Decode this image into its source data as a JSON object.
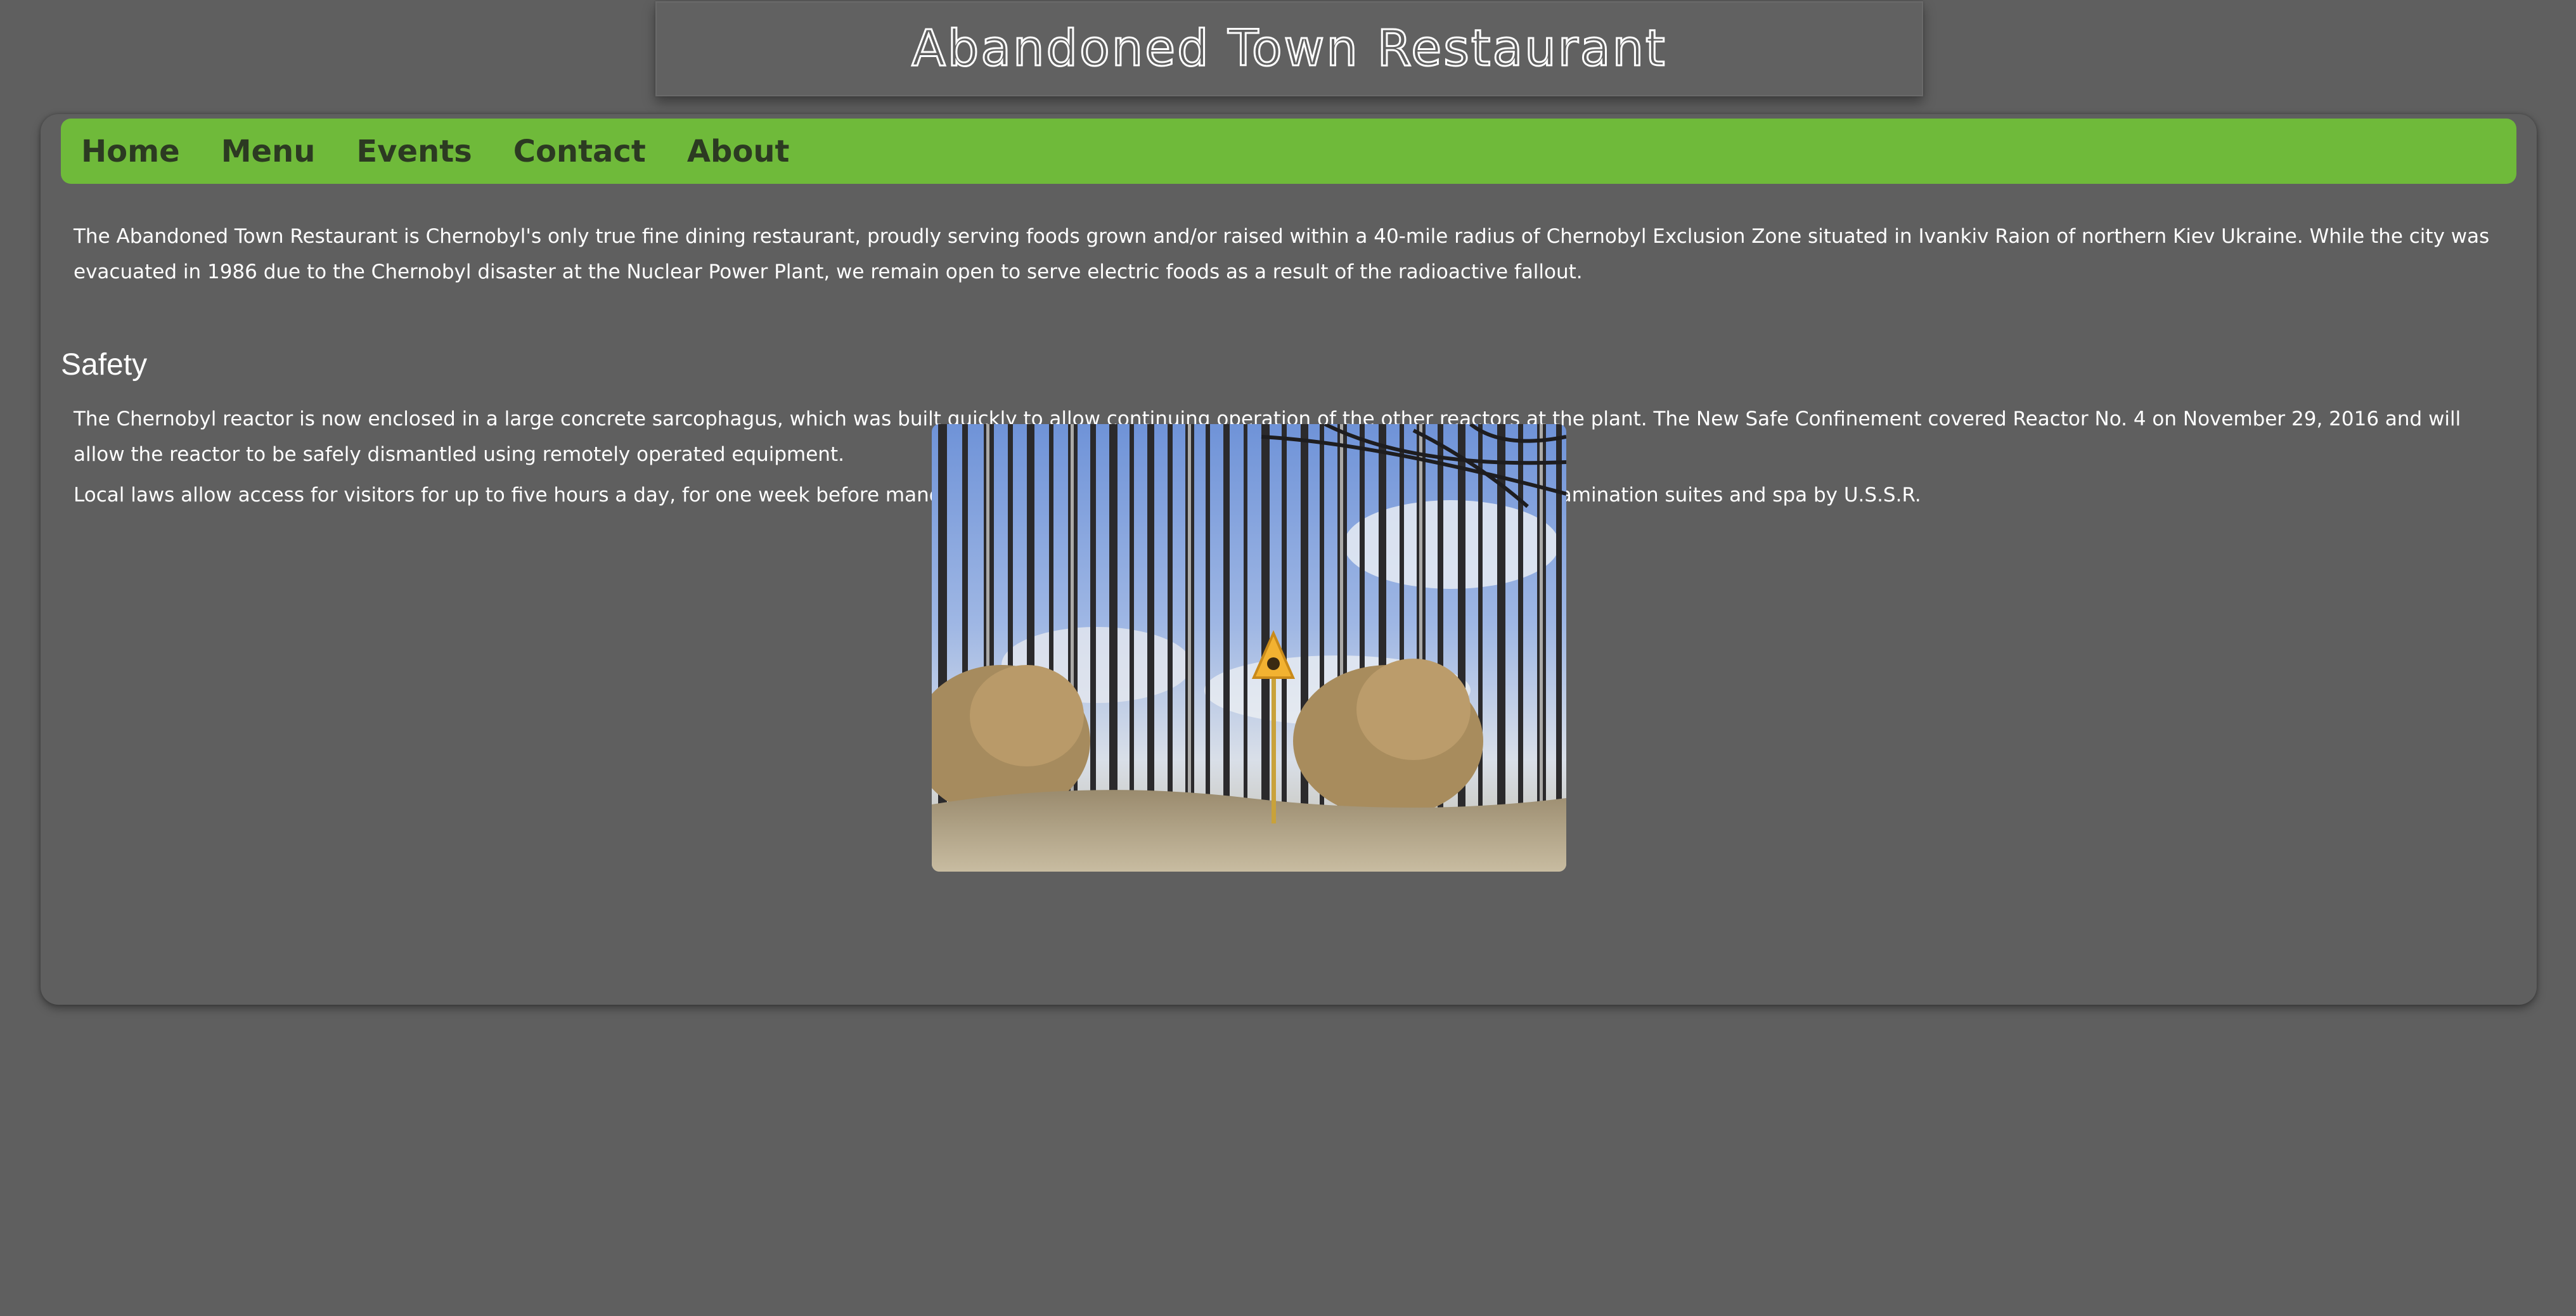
{
  "header": {
    "title": "Abandoned Town Restaurant"
  },
  "nav": {
    "items": [
      {
        "label": "Home"
      },
      {
        "label": "Menu"
      },
      {
        "label": "Events"
      },
      {
        "label": "Contact"
      },
      {
        "label": "About"
      }
    ]
  },
  "intro": {
    "text": "The Abandoned Town Restaurant is Chernobyl's only true fine dining restaurant, proudly serving foods grown and/or raised within a 40-mile radius of Chernobyl Exclusion Zone situated in Ivankiv Raion of northern Kiev Ukraine. While the city was evacuated in 1986 due to the Chernobyl disaster at the Nuclear Power Plant, we remain open to serve electric foods as a result of the radioactive fallout."
  },
  "safety": {
    "heading": "Safety",
    "paragraphs": [
      "The Chernobyl reactor is now enclosed in a large concrete sarcophagus, which was built quickly to allow continuing operation of the other reactors at the plant. The New Safe Confinement covered Reactor No. 4 on November 29, 2016 and will allow the reactor to be safely dismantled using remotely operated equipment.",
      "Local laws allow access for visitors for up to five hours a day, for one week before mandatory 15 days decontamination at the world-class Putin decontamination suites and spa by U.S.S.R."
    ]
  },
  "colors": {
    "page_background": "#5f5f5f",
    "nav_background": "#6fba3a",
    "nav_text": "#2c3a22",
    "body_text": "#ffffff"
  },
  "image": {
    "subject": "forest-radiation-warning-sign"
  }
}
